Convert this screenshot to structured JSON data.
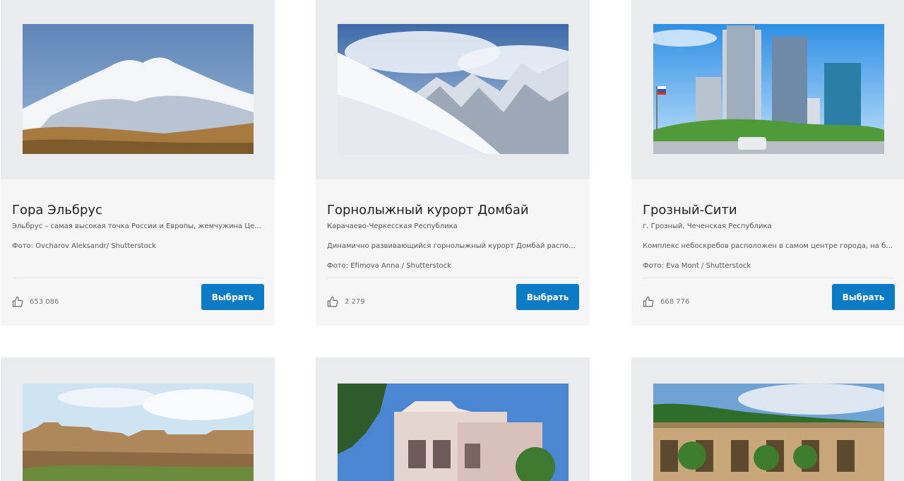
{
  "cards": [
    {
      "title": "Гора Эльбрус",
      "subtitle": "Эльбрус – самая высокая точка России и Европы, жемчужина Це...",
      "description": "",
      "photo": "Фото: Ovcharov Aleksandr/ Shutterstock",
      "likes": "653 086",
      "button": "Выбрать",
      "image_icon": "mountain-elbrus"
    },
    {
      "title": "Горнолыжный курорт Домбай",
      "subtitle": "Карачаево-Черкесская Республика",
      "description": "Динамично развивающийся горнолыжный курорт Домбай распо...",
      "photo": "Фото: Efimova Anna / Shutterstock",
      "likes": "2 279",
      "button": "Выбрать",
      "image_icon": "ski-slope"
    },
    {
      "title": "Грозный-Сити",
      "subtitle": "г. Грозный, Чеченская Республика",
      "description": "Комплекс небоскребов расположен в самом центре города, на б...",
      "photo": "Фото: Eva Mont / Shutterstock",
      "likes": "668 776",
      "button": "Выбрать",
      "image_icon": "skyscrapers"
    },
    {
      "image_icon": "fortress"
    },
    {
      "image_icon": "historic-building"
    },
    {
      "image_icon": "colonnade-park"
    }
  ],
  "colors": {
    "button": "#0b7bc6",
    "card_bg": "#f6f6f6",
    "image_bg": "#e9ebee"
  }
}
